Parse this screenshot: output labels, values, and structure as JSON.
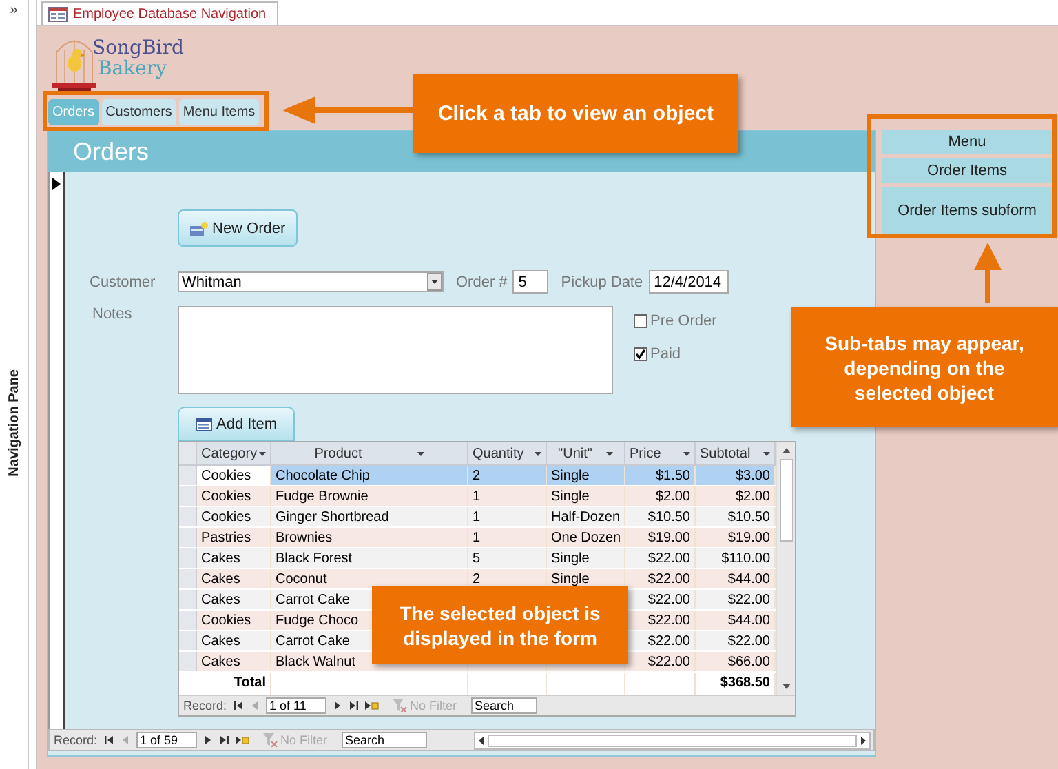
{
  "navigation_pane": {
    "toggle": "»",
    "label": "Navigation Pane"
  },
  "document_tab": {
    "title": "Employee Database Navigation"
  },
  "logo": {
    "line_1": "SongBird",
    "line_2": "Bakery"
  },
  "tabs": [
    {
      "label": "Orders",
      "selected": true
    },
    {
      "label": "Customers",
      "selected": false
    },
    {
      "label": "Menu Items",
      "selected": false
    }
  ],
  "form": {
    "title": "Orders",
    "new_order_button": "New Order",
    "customer": {
      "label": "Customer",
      "value": "Whitman"
    },
    "order_number": {
      "label": "Order #",
      "value": "5"
    },
    "pickup_date": {
      "label": "Pickup Date",
      "value": "12/4/2014"
    },
    "notes": {
      "label": "Notes"
    },
    "checkboxes": [
      {
        "label": "Pre Order",
        "checked": false
      },
      {
        "label": "Paid",
        "checked": true
      }
    ],
    "add_item_button": "Add Item",
    "order_items": {
      "columns": [
        "Category",
        "Product",
        "Quantity",
        "\"Unit\"",
        "Price",
        "Subtotal"
      ],
      "rows": [
        {
          "category": "Cookies",
          "product": "Chocolate Chip",
          "quantity": "2",
          "unit": "Single",
          "price": "$1.50",
          "subtotal": "$3.00",
          "selected": true
        },
        {
          "category": "Cookies",
          "product": "Fudge Brownie",
          "quantity": "1",
          "unit": "Single",
          "price": "$2.00",
          "subtotal": "$2.00",
          "selected": false
        },
        {
          "category": "Cookies",
          "product": "Ginger Shortbread",
          "quantity": "1",
          "unit": "Half-Dozen",
          "price": "$10.50",
          "subtotal": "$10.50",
          "selected": false
        },
        {
          "category": "Pastries",
          "product": "Brownies",
          "quantity": "1",
          "unit": "One Dozen",
          "price": "$19.00",
          "subtotal": "$19.00",
          "selected": false
        },
        {
          "category": "Cakes",
          "product": "Black Forest",
          "quantity": "5",
          "unit": "Single",
          "price": "$22.00",
          "subtotal": "$110.00",
          "selected": false
        },
        {
          "category": "Cakes",
          "product": "Coconut",
          "quantity": "2",
          "unit": "Single",
          "price": "$22.00",
          "subtotal": "$44.00",
          "selected": false
        },
        {
          "category": "Cakes",
          "product": "Carrot Cake",
          "price": "$22.00",
          "subtotal": "$22.00",
          "selected": false
        },
        {
          "category": "Cookies",
          "product": "Fudge Choco",
          "price": "$22.00",
          "subtotal": "$44.00",
          "selected": false
        },
        {
          "category": "Cakes",
          "product": "Carrot Cake",
          "price": "$22.00",
          "subtotal": "$22.00",
          "selected": false
        },
        {
          "category": "Cakes",
          "product": "Black Walnut",
          "price": "$22.00",
          "subtotal": "$66.00",
          "selected": false
        }
      ],
      "total": {
        "label": "Total",
        "value": "$368.50"
      },
      "record_nav": {
        "label": "Record:",
        "position": "1 of 11",
        "filter": "No Filter",
        "search": "Search"
      }
    },
    "record_nav": {
      "label": "Record:",
      "position": "1 of 59",
      "filter": "No Filter",
      "search": "Search"
    }
  },
  "sub_tabs": [
    {
      "label": "Menu"
    },
    {
      "label": "Order Items"
    },
    {
      "label": "Order Items subform"
    }
  ],
  "callouts": [
    {
      "text": "Click a tab to view an object"
    },
    {
      "text": "Sub-tabs may appear, depending on the selected object"
    },
    {
      "text": "The selected object is displayed in the form"
    }
  ]
}
